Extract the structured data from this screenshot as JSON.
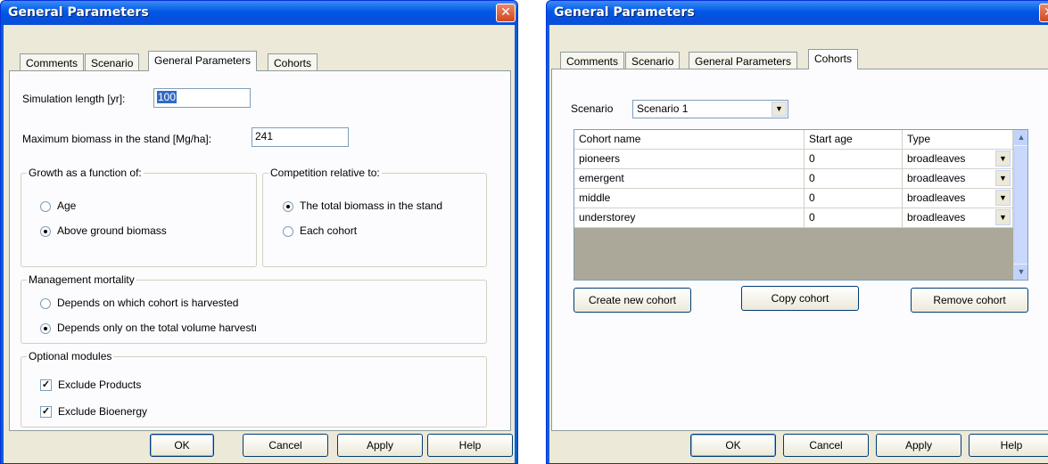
{
  "left_dialog": {
    "title": "General Parameters",
    "tabs": [
      "Comments",
      "Scenario",
      "General Parameters",
      "Cohorts"
    ],
    "active_tab": "General Parameters",
    "simulation_length": {
      "label": "Simulation length [yr]:",
      "value": "100"
    },
    "max_biomass": {
      "label": "Maximum biomass in the stand [Mg/ha]:",
      "value": "241"
    },
    "growth_group": {
      "title": "Growth as a function of:",
      "options": [
        "Age",
        "Above ground biomass"
      ],
      "selected": "Above ground biomass"
    },
    "competition_group": {
      "title": "Competition relative to:",
      "options": [
        "The total biomass in the stand",
        "Each cohort"
      ],
      "selected": "The total biomass in the stand"
    },
    "mortality_group": {
      "title": "Management mortality",
      "options": [
        "Depends on which cohort is harvested",
        "Depends only on the total volume harvestı"
      ],
      "selected": "Depends only on the total volume harvestı"
    },
    "optional_group": {
      "title": "Optional modules",
      "checkboxes": [
        {
          "label": "Exclude Products",
          "checked": true
        },
        {
          "label": "Exclude Bioenergy",
          "checked": true
        }
      ]
    },
    "buttons": {
      "ok": "OK",
      "cancel": "Cancel",
      "apply": "Apply",
      "help": "Help"
    }
  },
  "right_dialog": {
    "title": "General Parameters",
    "tabs": [
      "Comments",
      "Scenario",
      "General Parameters",
      "Cohorts"
    ],
    "active_tab": "Cohorts",
    "scenario": {
      "label": "Scenario",
      "value": "Scenario 1"
    },
    "table": {
      "columns": [
        "Cohort name",
        "Start age",
        "Type"
      ],
      "rows": [
        {
          "name": "pioneers",
          "start_age": "0",
          "type": "broadleaves"
        },
        {
          "name": "emergent",
          "start_age": "0",
          "type": "broadleaves"
        },
        {
          "name": "middle",
          "start_age": "0",
          "type": "broadleaves"
        },
        {
          "name": "understorey",
          "start_age": "0",
          "type": "broadleaves"
        }
      ]
    },
    "actions": {
      "create": "Create new cohort",
      "copy": "Copy cohort",
      "remove": "Remove cohort"
    },
    "buttons": {
      "ok": "OK",
      "cancel": "Cancel",
      "apply": "Apply",
      "help": "Help"
    }
  },
  "icons": {
    "close": "close-icon",
    "dropdown": "chevron-down-icon",
    "scroll_up": "scroll-up-icon",
    "scroll_down": "scroll-down-icon",
    "check": "checkmark-icon"
  },
  "colors": {
    "titlebar": "#0058e6",
    "dialog_bg": "#ece9d8",
    "panel_bg": "#fcfcfe",
    "selection": "#316ac5",
    "close_button": "#d3471e"
  }
}
